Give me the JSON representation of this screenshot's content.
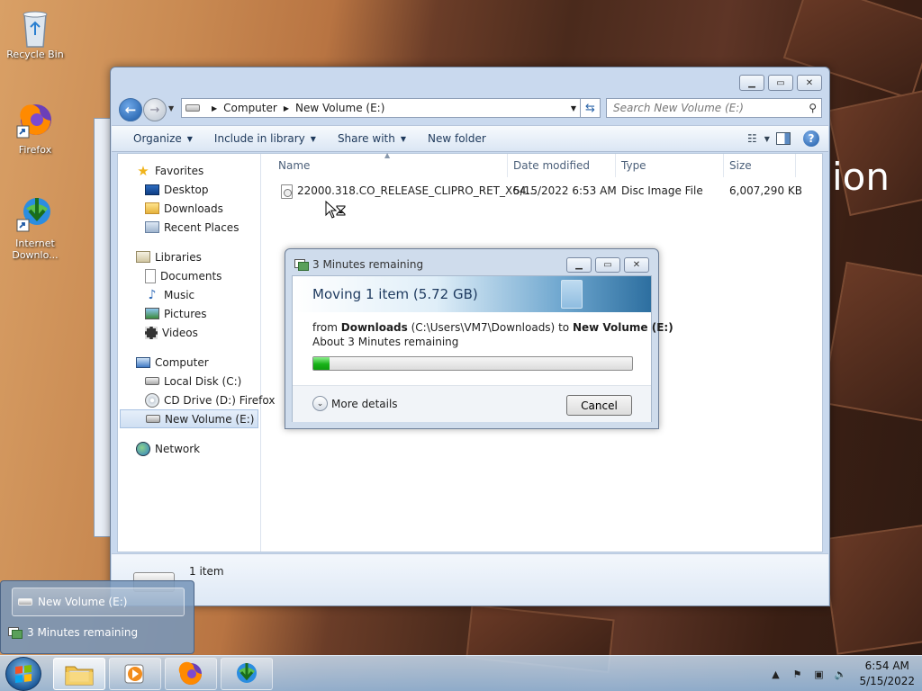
{
  "desktop": {
    "icons": [
      {
        "label": "Recycle Bin"
      },
      {
        "label": "Firefox"
      },
      {
        "label": "Internet Downlo..."
      }
    ],
    "wallpaper_text": "ion"
  },
  "explorer": {
    "address": {
      "crumbs": [
        "Computer",
        "New Volume (E:)"
      ]
    },
    "search_placeholder": "Search New Volume (E:)",
    "toolbar": {
      "organize": "Organize",
      "include_in_library": "Include in library",
      "share_with": "Share with",
      "new_folder": "New folder"
    },
    "nav": {
      "favorites": "Favorites",
      "desktop": "Desktop",
      "downloads": "Downloads",
      "recent_places": "Recent Places",
      "libraries": "Libraries",
      "documents": "Documents",
      "music": "Music",
      "pictures": "Pictures",
      "videos": "Videos",
      "computer": "Computer",
      "local_disk": "Local Disk (C:)",
      "cd_drive": "CD Drive (D:) Firefox",
      "new_volume": "New Volume (E:)",
      "network": "Network"
    },
    "columns": {
      "name": "Name",
      "date_modified": "Date modified",
      "type": "Type",
      "size": "Size"
    },
    "files": [
      {
        "name": "22000.318.CO_RELEASE_CLIPRO_RET_X64...",
        "date": "5/15/2022 6:53 AM",
        "type": "Disc Image File",
        "size": "6,007,290 KB"
      }
    ],
    "details": {
      "item_count": "1 item"
    }
  },
  "dialog": {
    "title": "3 Minutes remaining",
    "heading": "Moving 1 item (5.72 GB)",
    "from_prefix": "from",
    "from_name": "Downloads",
    "from_path": "(C:\\Users\\VM7\\Downloads)",
    "to_word": "to",
    "to_name": "New Volume (E:)",
    "remaining": "About 3 Minutes remaining",
    "progress": 0.05,
    "more_details": "More details",
    "cancel": "Cancel"
  },
  "taskbar_preview": {
    "items": [
      "New Volume (E:)",
      "3 Minutes remaining"
    ]
  },
  "taskbar": {
    "time": "6:54 AM",
    "date": "5/15/2022"
  },
  "colors": {
    "progress_green": "#18b318",
    "toolbar_text": "#1e395b",
    "selection_blue": "#cfdff2"
  }
}
